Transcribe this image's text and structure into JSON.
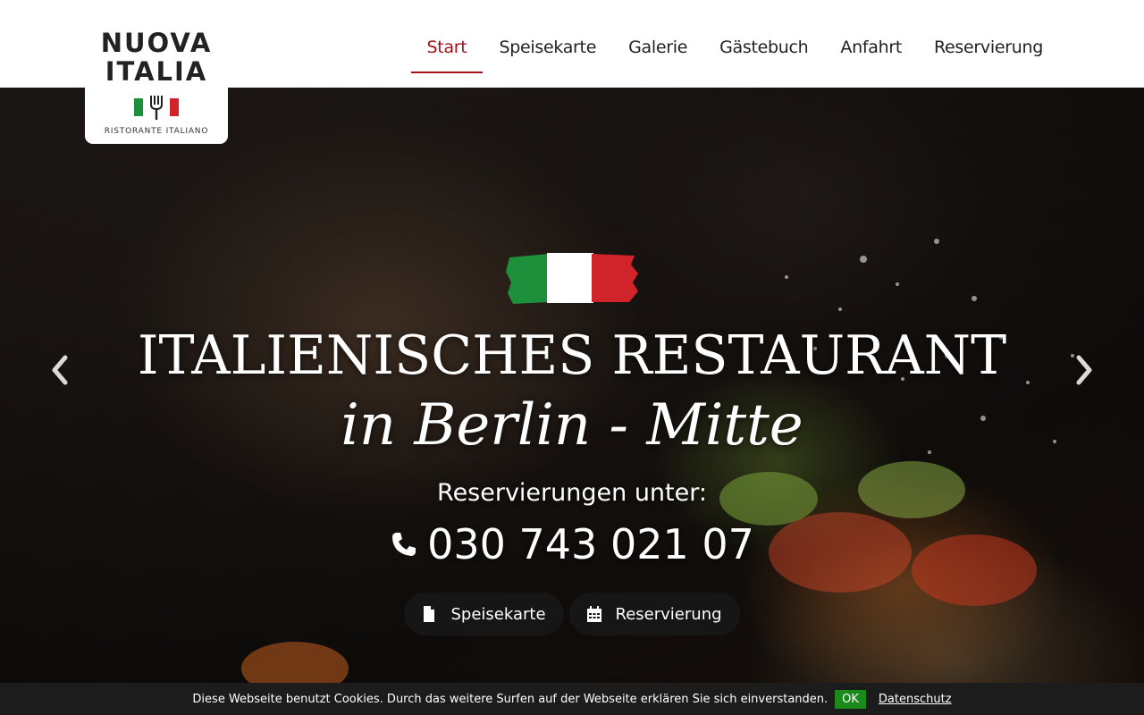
{
  "logo": {
    "line1": "NUOVA",
    "line2": "ITALIA",
    "tagline": "RISTORANTE ITALIANO"
  },
  "nav": {
    "items": [
      {
        "label": "Start",
        "active": true
      },
      {
        "label": "Speisekarte",
        "active": false
      },
      {
        "label": "Galerie",
        "active": false
      },
      {
        "label": "Gästebuch",
        "active": false
      },
      {
        "label": "Anfahrt",
        "active": false
      },
      {
        "label": "Reservierung",
        "active": false
      }
    ]
  },
  "hero": {
    "title": "ITALIENISCHES RESTAURANT",
    "subtitle": "in Berlin - Mitte",
    "reserve_label": "Reservierungen unter:",
    "phone": "030 743 021 07",
    "buttons": [
      {
        "label": "Speisekarte",
        "icon": "file-icon"
      },
      {
        "label": "Reservierung",
        "icon": "calendar-icon"
      }
    ]
  },
  "cookie": {
    "text": "Diese Webseite benutzt Cookies. Durch das weitere Surfen auf der Webseite erklären Sie sich einverstanden.",
    "ok_label": "OK",
    "link_label": "Datenschutz"
  },
  "colors": {
    "accent": "#a5121a",
    "flag_green": "#1e8f3a",
    "flag_white": "#ffffff",
    "flag_red": "#d1232a",
    "cookie_ok": "#1a8a1a"
  }
}
